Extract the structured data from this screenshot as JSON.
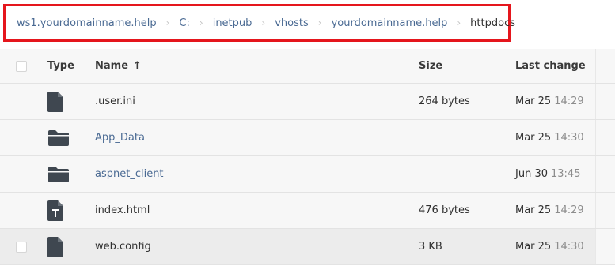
{
  "breadcrumb": [
    {
      "label": "ws1.yourdomainname.help",
      "current": false
    },
    {
      "label": "C:",
      "current": false
    },
    {
      "label": "inetpub",
      "current": false
    },
    {
      "label": "vhosts",
      "current": false
    },
    {
      "label": "yourdomainname.help",
      "current": false
    },
    {
      "label": "httpdocs",
      "current": true
    }
  ],
  "breadcrumb_separator": "›",
  "table": {
    "headers": {
      "type": "Type",
      "name": "Name",
      "sort_indicator": "↑",
      "size": "Size",
      "last_change": "Last change"
    },
    "rows": [
      {
        "icon": "file-icon",
        "name": ".user.ini",
        "is_link": false,
        "size": "264 bytes",
        "date": "Mar 25",
        "time": "14:29"
      },
      {
        "icon": "folder-icon",
        "name": "App_Data",
        "is_link": true,
        "size": "",
        "date": "Mar 25",
        "time": "14:30"
      },
      {
        "icon": "folder-icon",
        "name": "aspnet_client",
        "is_link": true,
        "size": "",
        "date": "Jun 30",
        "time": "13:45"
      },
      {
        "icon": "text-file-icon",
        "name": "index.html",
        "is_link": false,
        "size": "476 bytes",
        "date": "Mar 25",
        "time": "14:29"
      },
      {
        "icon": "file-icon",
        "name": "web.config",
        "is_link": false,
        "size": "3 KB",
        "date": "Mar 25",
        "time": "14:30"
      }
    ]
  },
  "colors": {
    "highlight_border": "#e5161d",
    "link": "#4a6a93",
    "icon": "#3f4750",
    "muted": "#8c8c8c"
  }
}
